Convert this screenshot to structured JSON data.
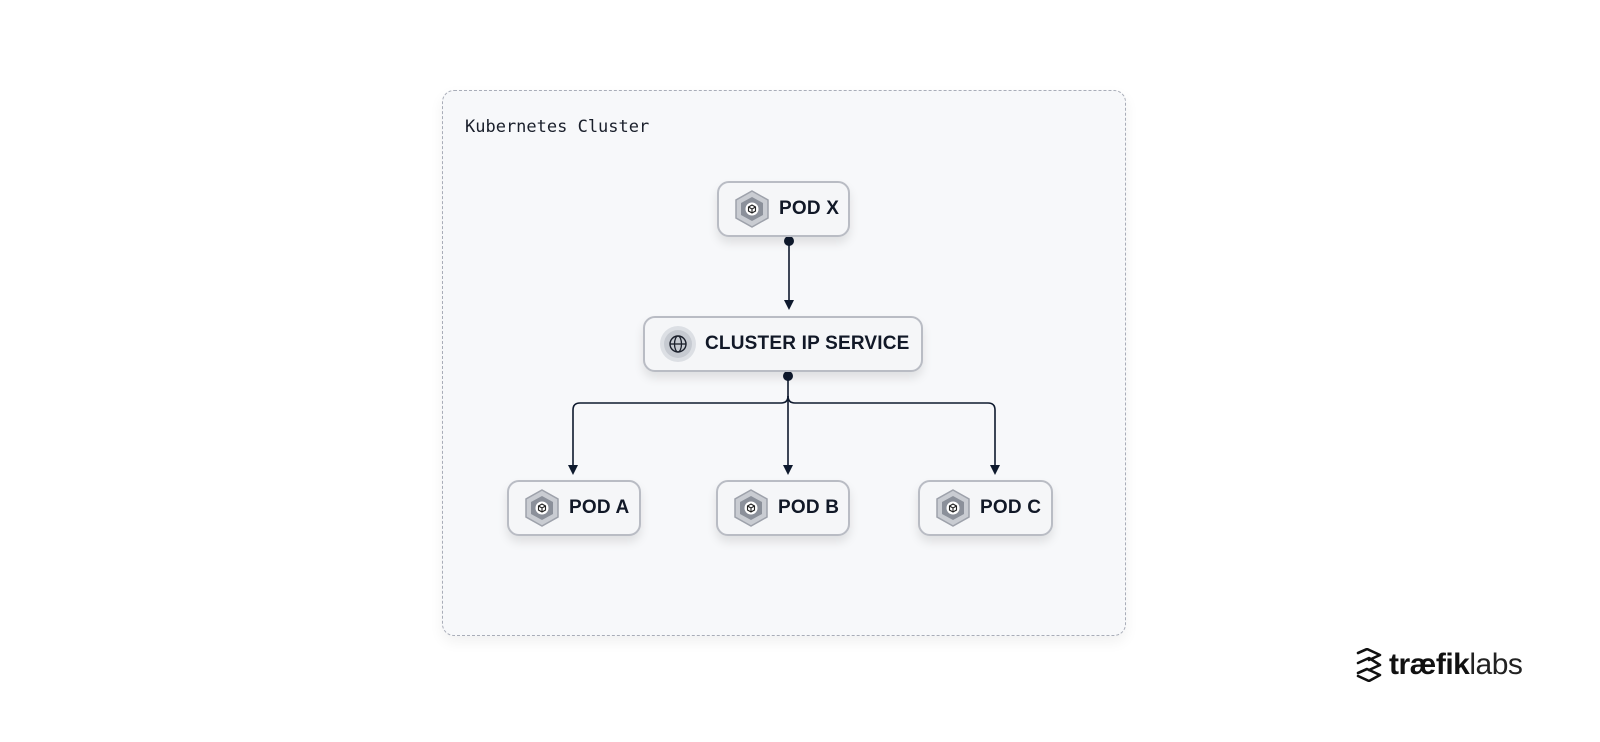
{
  "cluster": {
    "label": "Kubernetes Cluster"
  },
  "nodes": {
    "pod_x": {
      "label": "POD X",
      "icon": "pod-cube-icon"
    },
    "service": {
      "label": "CLUSTER IP SERVICE",
      "icon": "globe-icon"
    },
    "pod_a": {
      "label": "POD A",
      "icon": "pod-cube-icon"
    },
    "pod_b": {
      "label": "POD B",
      "icon": "pod-cube-icon"
    },
    "pod_c": {
      "label": "POD C",
      "icon": "pod-cube-icon"
    }
  },
  "edges": [
    {
      "from": "POD X",
      "to": "CLUSTER IP SERVICE"
    },
    {
      "from": "CLUSTER IP SERVICE",
      "to": "POD A"
    },
    {
      "from": "CLUSTER IP SERVICE",
      "to": "POD B"
    },
    {
      "from": "CLUSTER IP SERVICE",
      "to": "POD C"
    }
  ],
  "logo": {
    "brand_bold": "træfik",
    "brand_light": "labs"
  },
  "colors": {
    "line": "#0f1a2e",
    "node_border": "#b9bcc4",
    "icon_gray": "#8b909a"
  }
}
